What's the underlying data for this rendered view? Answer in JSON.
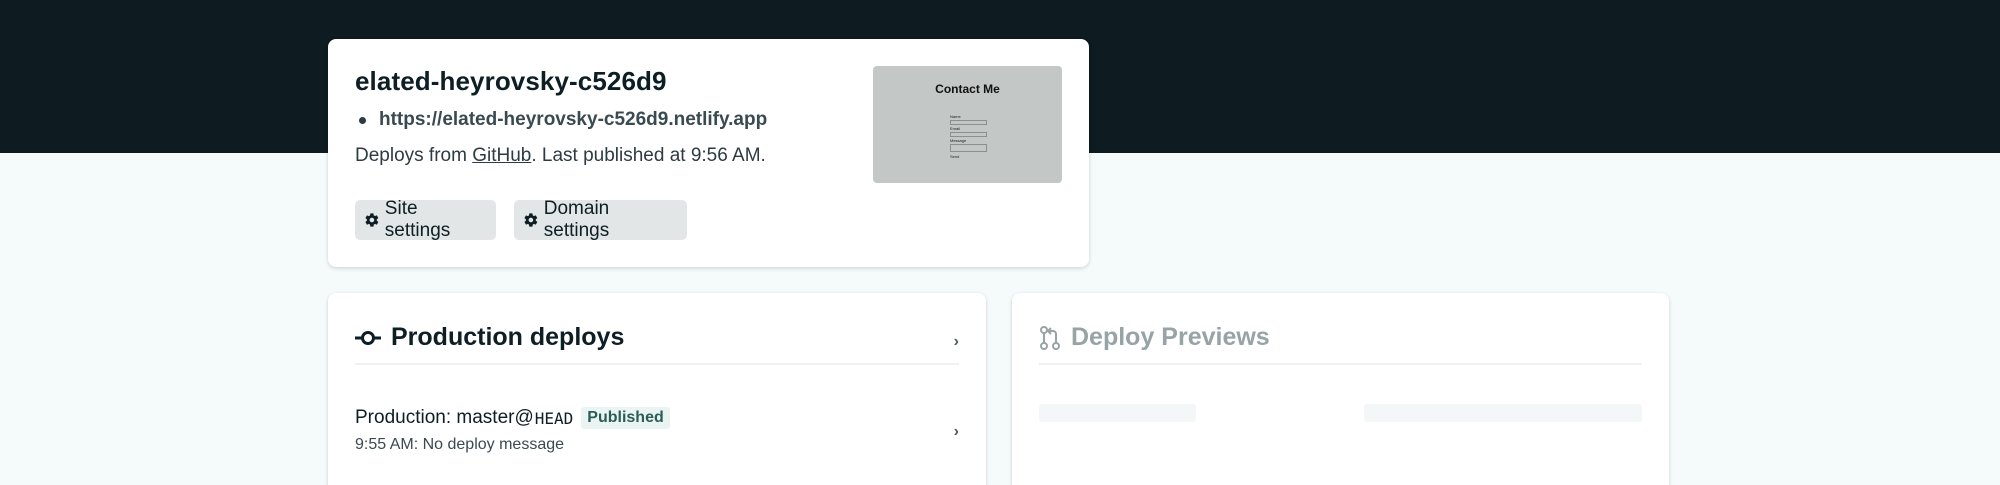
{
  "site": {
    "name": "elated-heyrovsky-c526d9",
    "url": "https://elated-heyrovsky-c526d9.netlify.app",
    "deploys_prefix": "Deploys from",
    "deploys_provider": "GitHub",
    "deploys_suffix": ". Last published at 9:56 AM.",
    "buttons": {
      "site_settings": "Site settings",
      "domain_settings": "Domain settings"
    },
    "preview": {
      "title": "Contact Me",
      "fields": [
        "Name",
        "Email",
        "Message",
        "Send"
      ]
    }
  },
  "production_deploys": {
    "title": "Production deploys",
    "item": {
      "label": "Production:",
      "branch": "master@",
      "ref": "HEAD",
      "status": "Published",
      "subtitle": "9:55 AM: No deploy message"
    }
  },
  "deploy_previews": {
    "title": "Deploy Previews"
  },
  "colors": {
    "header_bg": "#0e1b20",
    "page_bg": "#f5fafa",
    "badge_bg": "#eaf5f3",
    "badge_text": "#2b5d56"
  },
  "icons": {
    "settings": "gear-icon",
    "production": "git-commit-icon",
    "previews": "git-pull-request-icon",
    "chevron": "chevron-right-icon"
  }
}
